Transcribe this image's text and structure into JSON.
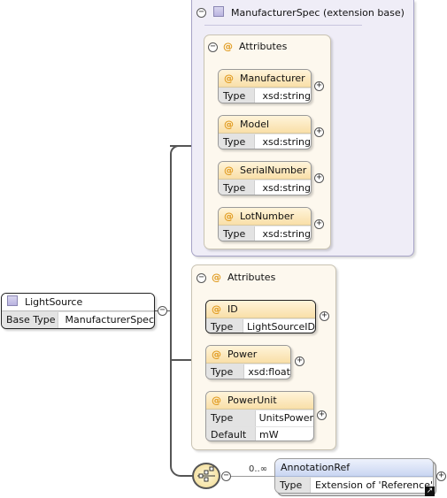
{
  "root": {
    "title": "LightSource",
    "rows": [
      {
        "key": "Base Type",
        "value": "ManufacturerSpec"
      }
    ]
  },
  "extension": {
    "title": "ManufacturerSpec (extension base)",
    "attributes_label": "Attributes",
    "items": [
      {
        "name": "Manufacturer",
        "type_key": "Type",
        "type": "xsd:string"
      },
      {
        "name": "Model",
        "type_key": "Type",
        "type": "xsd:string"
      },
      {
        "name": "SerialNumber",
        "type_key": "Type",
        "type": "xsd:string"
      },
      {
        "name": "LotNumber",
        "type_key": "Type",
        "type": "xsd:string"
      }
    ]
  },
  "attributes": {
    "label": "Attributes",
    "items": [
      {
        "name": "ID",
        "type_key": "Type",
        "type": "LightSourceID"
      },
      {
        "name": "Power",
        "type_key": "Type",
        "type": "xsd:float"
      },
      {
        "name": "PowerUnit",
        "type_key": "Type",
        "type": "UnitsPower",
        "default_key": "Default",
        "default": "mW"
      }
    ]
  },
  "sequence": {
    "cardinality": "0..∞",
    "element": {
      "name": "AnnotationRef",
      "type_key": "Type",
      "type": "Extension of 'Reference'"
    }
  },
  "symbols": {
    "at": "@",
    "collapse": "−",
    "expand": "+",
    "link": "↗"
  },
  "colors": {
    "attribute_accent": "#e09a1e",
    "extension_bg": "#efedf7",
    "attributes_bg": "#fdf8ee",
    "element_header": "#c9d6f2"
  }
}
